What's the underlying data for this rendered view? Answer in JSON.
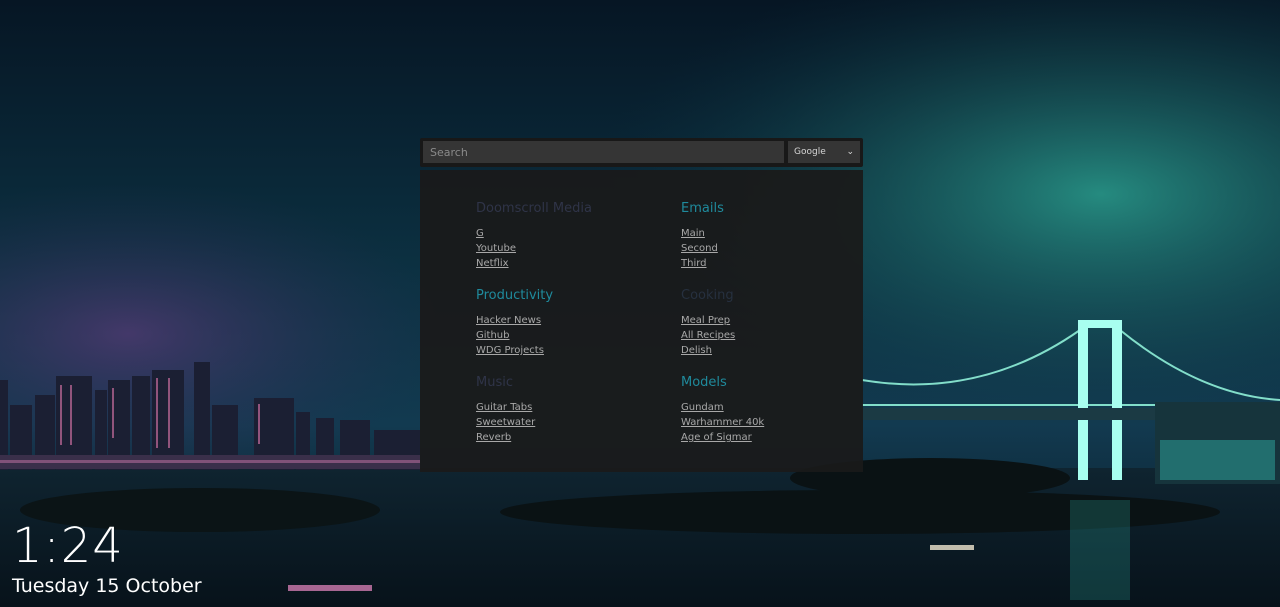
{
  "search": {
    "placeholder": "Search",
    "engine_selected": "Google",
    "engine_chevron": "⌄"
  },
  "groups": [
    {
      "title": "Doomscroll Media",
      "title_style": "dim",
      "links": [
        "G",
        "Youtube",
        "Netflix"
      ]
    },
    {
      "title": "Emails",
      "title_style": "cyan",
      "links": [
        "Main",
        "Second",
        "Third"
      ]
    },
    {
      "title": "Productivity",
      "title_style": "cyan",
      "links": [
        "Hacker News",
        "Github",
        "WDG Projects"
      ]
    },
    {
      "title": "Cooking",
      "title_style": "faint",
      "links": [
        "Meal Prep",
        "All Recipes",
        "Delish"
      ]
    },
    {
      "title": "Music",
      "title_style": "dim",
      "links": [
        "Guitar Tabs",
        "Sweetwater",
        "Reverb"
      ]
    },
    {
      "title": "Models",
      "title_style": "cyan",
      "links": [
        "Gundam",
        "Warhammer 40k",
        "Age of Sigmar"
      ]
    }
  ],
  "clock": {
    "time": "1:24",
    "date": "Tuesday 15 October"
  },
  "colors": {
    "accent": "#1f8a9c",
    "panel_bg": "#1a1a1a",
    "link": "#a8a8a8"
  }
}
